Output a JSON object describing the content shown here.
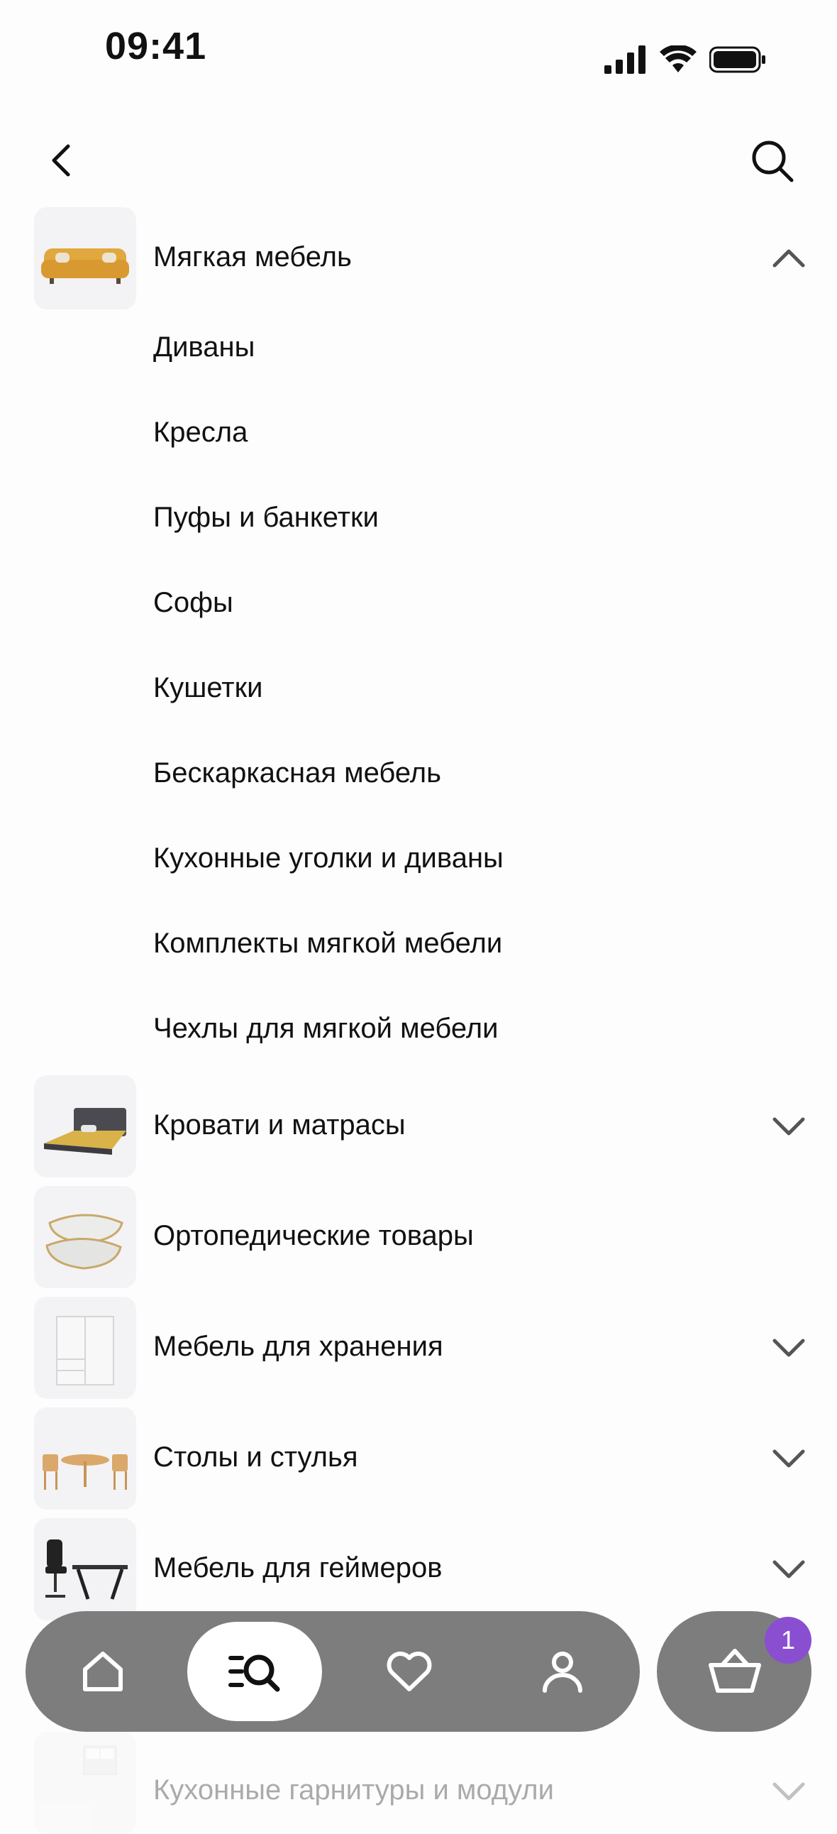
{
  "status": {
    "time": "09:41"
  },
  "expanded_category": {
    "label": "Мягкая мебель",
    "subitems": [
      "Диваны",
      "Кресла",
      "Пуфы и банкетки",
      "Софы",
      "Кушетки",
      "Бескаркасная мебель",
      "Кухонные уголки и диваны",
      "Комплекты мягкой мебели",
      "Чехлы для мягкой мебели"
    ]
  },
  "categories": [
    {
      "label": "Кровати и матрасы"
    },
    {
      "label": "Ортопедические товары"
    },
    {
      "label": "Мебель для хранения"
    },
    {
      "label": "Столы и стулья"
    },
    {
      "label": "Мебель для геймеров"
    },
    {
      "label": "Кухонные гарнитуры и модули"
    }
  ],
  "icons": {
    "back": "chevron-left-icon",
    "search": "search-icon",
    "nav": [
      "home-icon",
      "catalog-search-icon",
      "heart-icon",
      "user-icon"
    ],
    "cart": "basket-icon"
  },
  "cart": {
    "badge_count": "1"
  },
  "colors": {
    "nav_bg": "#7d7d7d",
    "badge": "#8a4fd0",
    "thumb_bg": "#f3f3f5"
  }
}
